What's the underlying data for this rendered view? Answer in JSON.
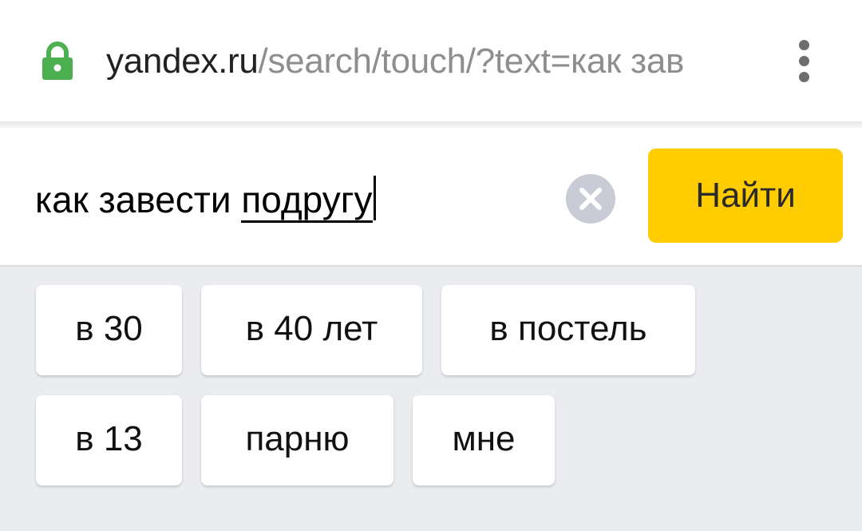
{
  "browser": {
    "lock_icon": "lock-icon",
    "lock_color": "#4caf50",
    "url_host": "yandex.ru",
    "url_path": "/search/touch/?text=как зав",
    "menu_icon": "more-vert-icon"
  },
  "search": {
    "query_typed": "как завести ",
    "query_completion": "подругу",
    "clear_icon": "clear-icon",
    "button_label": "Найти",
    "button_color": "#ffcc00"
  },
  "suggestions": [
    {
      "label": "в 30"
    },
    {
      "label": "в 40 лет"
    },
    {
      "label": "в постель"
    },
    {
      "label": "в 13"
    },
    {
      "label": "парню"
    },
    {
      "label": "мне"
    }
  ]
}
